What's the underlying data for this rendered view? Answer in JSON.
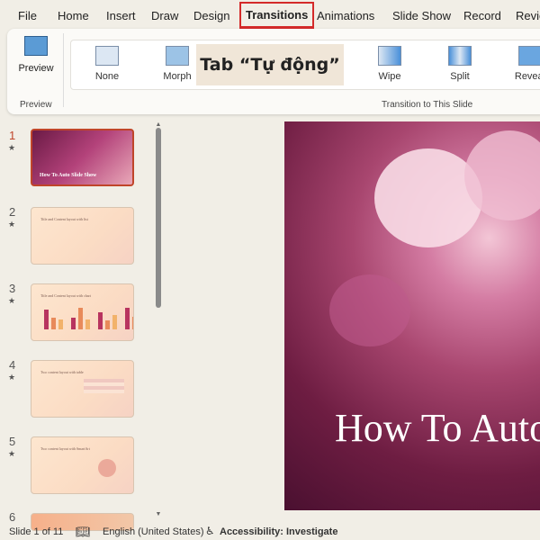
{
  "menu": {
    "items": [
      "File",
      "Home",
      "Insert",
      "Draw",
      "Design",
      "Transitions",
      "Animations",
      "Slide Show",
      "Record",
      "Revie"
    ],
    "active": "Transitions"
  },
  "ribbon": {
    "preview_button": "Preview",
    "preview_group": "Preview",
    "transitions": [
      "None",
      "Morph",
      "Wipe",
      "Split",
      "Reveal"
    ],
    "group_label": "Transition to This Slide"
  },
  "callout": "Tab “Tự động”",
  "slides": [
    {
      "number": "1",
      "title": "How To Auto Slide Show"
    },
    {
      "number": "2",
      "title": "Title and Content layout with list"
    },
    {
      "number": "3",
      "title": "Title and Content layout with chart"
    },
    {
      "number": "4",
      "title": "Two content layout with table"
    },
    {
      "number": "5",
      "title": "Two content layout with SmartArt"
    },
    {
      "number": "6",
      "title": ""
    }
  ],
  "main_slide": {
    "title": "How To Auto Slide Show"
  },
  "status": {
    "slide": "Slide 1 of 11",
    "language": "English (United States)",
    "accessibility": "Accessibility: Investigate"
  },
  "colors": {
    "accent": "#d42a2a",
    "selected_thumb": "#c0452a"
  }
}
